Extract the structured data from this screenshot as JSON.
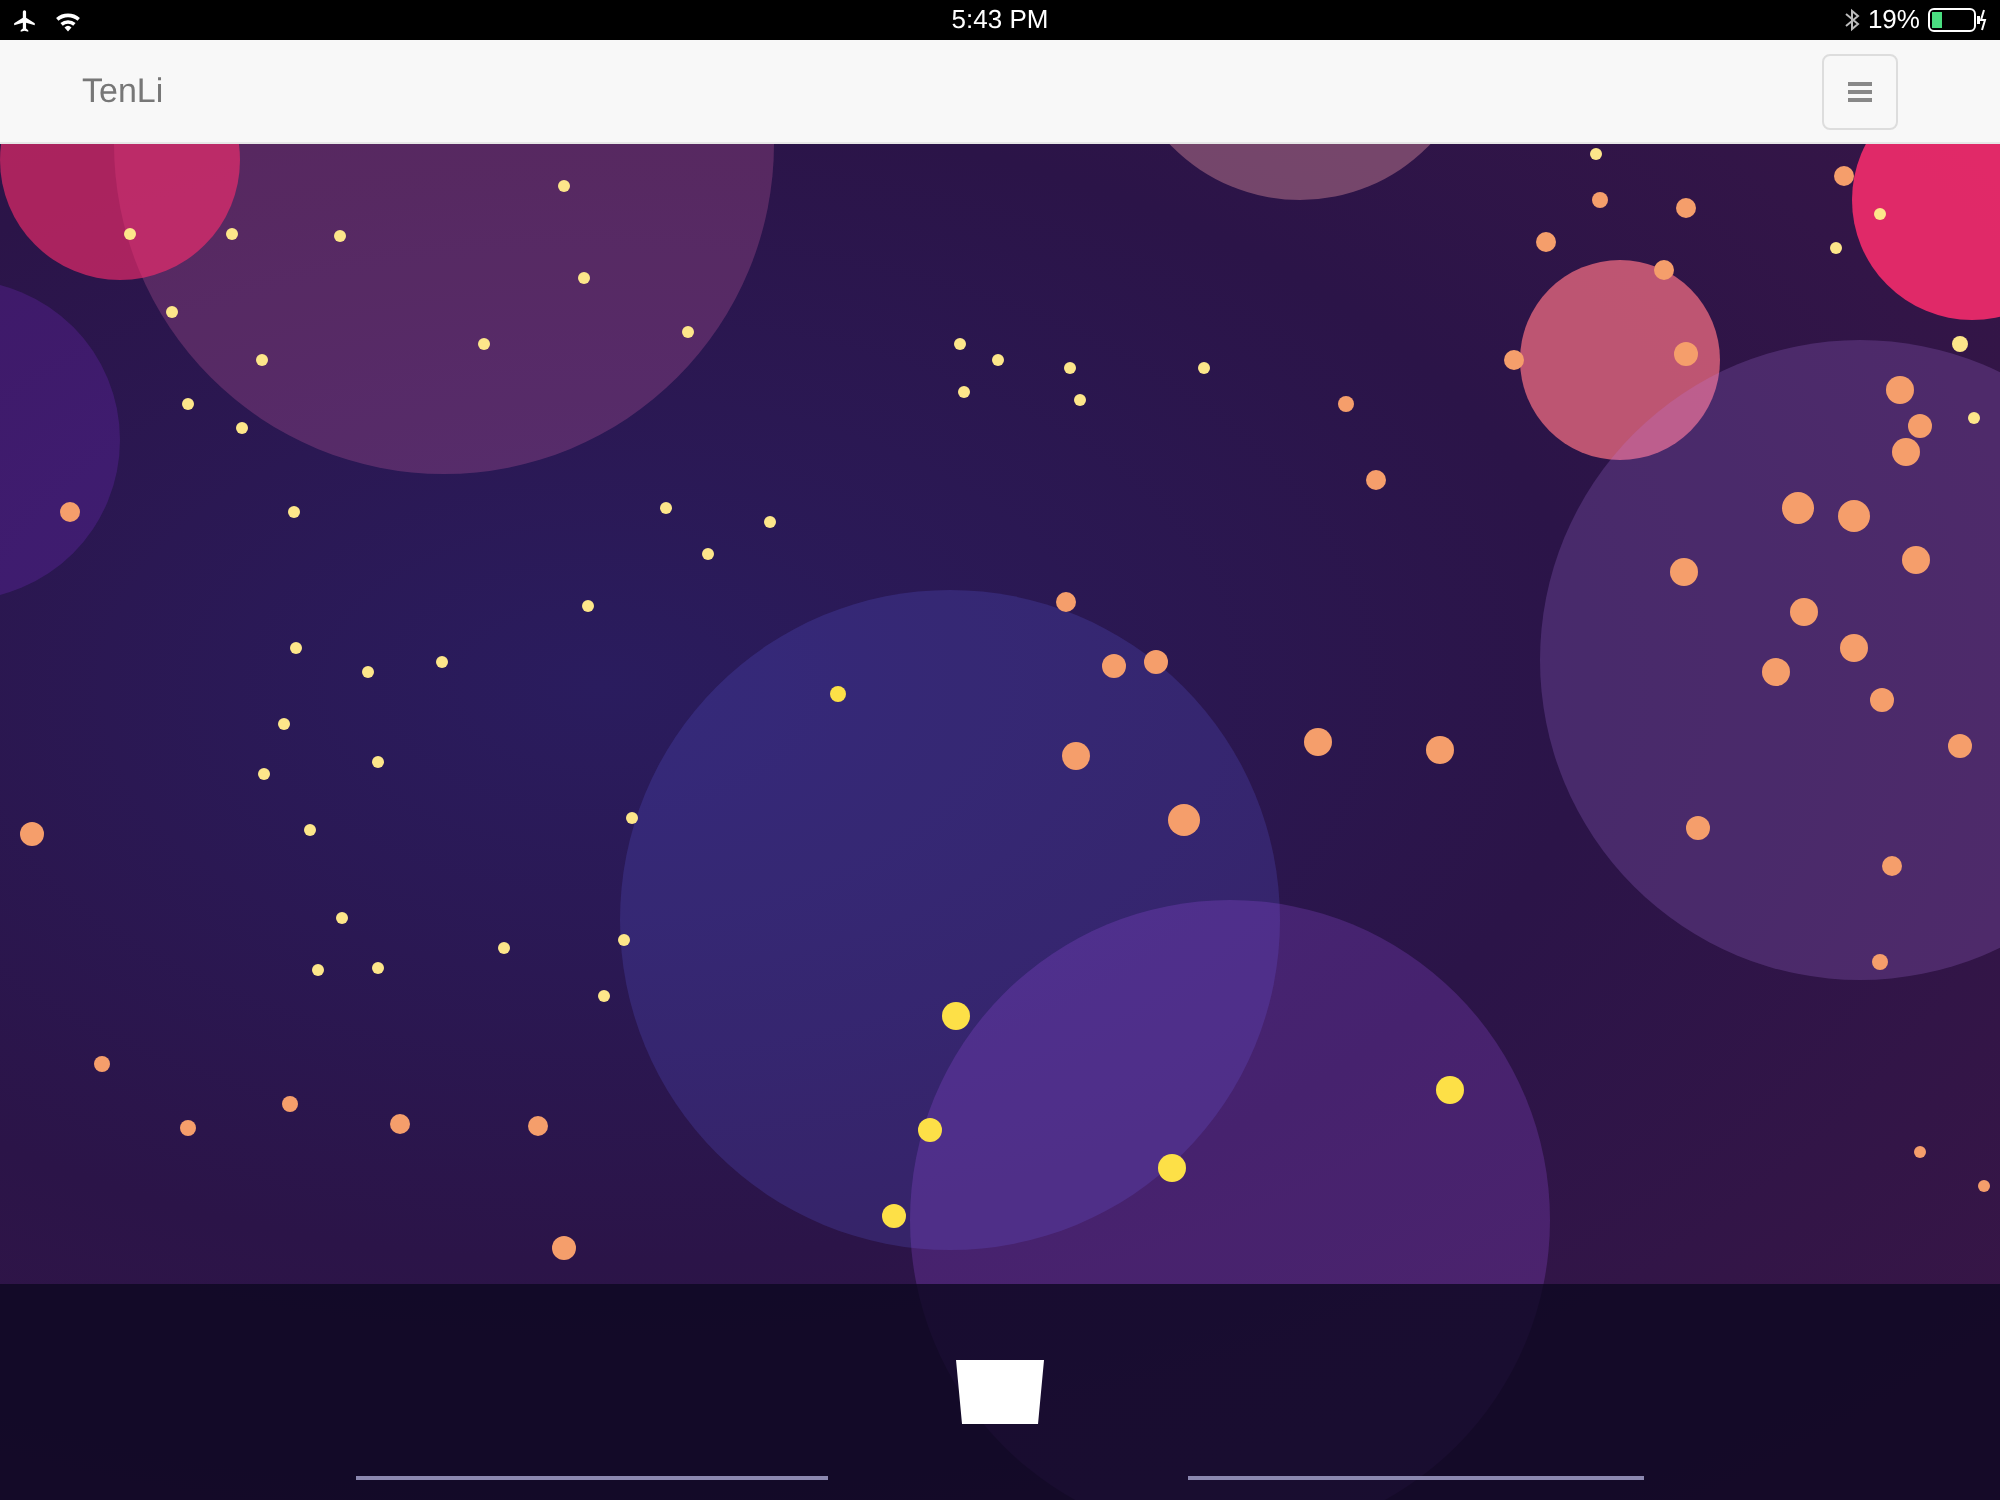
{
  "status_bar": {
    "time": "5:43 PM",
    "battery": "19%"
  },
  "navbar": {
    "brand": "TenLi"
  }
}
